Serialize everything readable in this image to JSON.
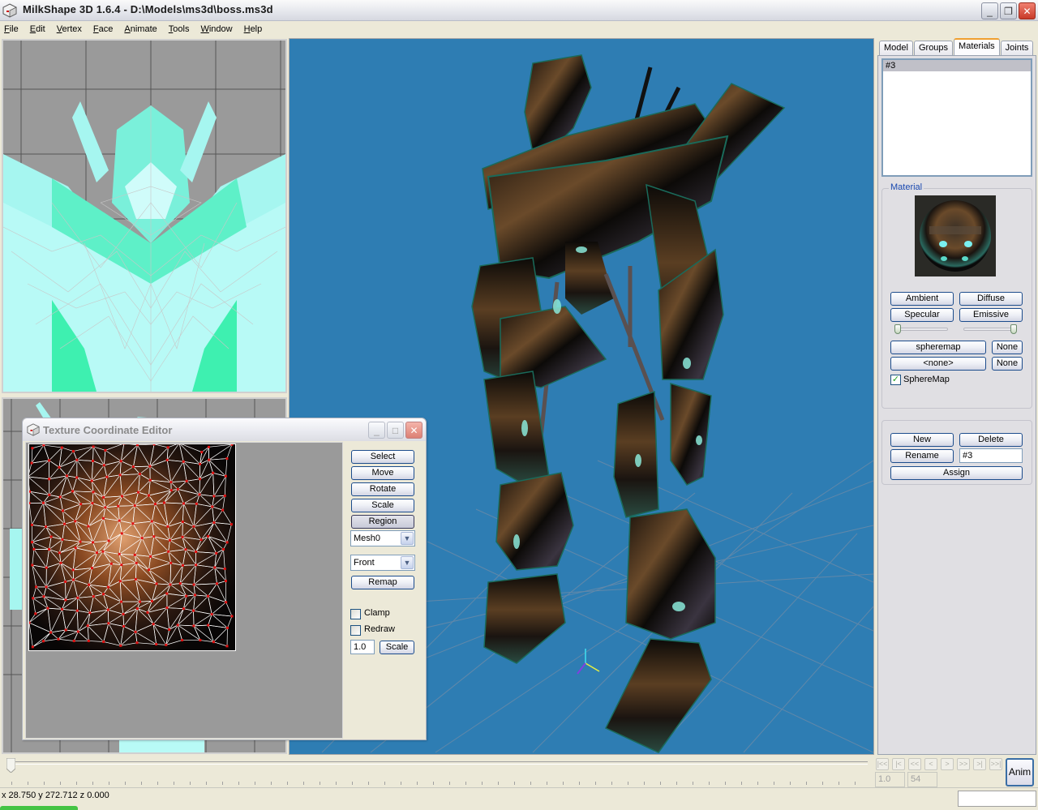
{
  "window": {
    "title": "MilkShape 3D 1.6.4 - D:\\Models\\ms3d\\boss.ms3d",
    "icon": "milkshape-cube-icon",
    "controls": {
      "minimize": "_",
      "restore": "❐",
      "close": "✕"
    }
  },
  "menu": [
    "File",
    "Edit",
    "Vertex",
    "Face",
    "Animate",
    "Tools",
    "Window",
    "Help"
  ],
  "viewports": {
    "front": {
      "name": "front-wireframe-view"
    },
    "side": {
      "name": "side-wireframe-view"
    },
    "perspective": {
      "name": "3d-perspective-view",
      "background": "#2e7db3"
    }
  },
  "right_panel": {
    "tabs": [
      {
        "label": "Model",
        "active": false
      },
      {
        "label": "Groups",
        "active": false
      },
      {
        "label": "Materials",
        "active": true
      },
      {
        "label": "Joints",
        "active": false
      }
    ],
    "materials": [
      "#3"
    ],
    "selected_material": "#3",
    "material_group_label": "Material",
    "buttons": {
      "ambient": "Ambient",
      "diffuse": "Diffuse",
      "specular": "Specular",
      "emissive": "Emissive",
      "texture1": "spheremap",
      "texture1_none": "None",
      "texture2": "<none>",
      "texture2_none": "None"
    },
    "shininess_slider": 0.0,
    "transparency_slider": 1.0,
    "spheremap_checkbox": {
      "label": "SphereMap",
      "checked": true
    },
    "actions": {
      "new": "New",
      "delete": "Delete",
      "rename": "Rename",
      "rename_value": "#3",
      "assign": "Assign"
    }
  },
  "texture_editor": {
    "title": "Texture Coordinate Editor",
    "controls": {
      "minimize": "_",
      "maximize": "□",
      "close": "✕"
    },
    "buttons": {
      "select": "Select",
      "move": "Move",
      "rotate": "Rotate",
      "scale": "Scale",
      "region": "Region",
      "remap": "Remap",
      "scale_apply": "Scale"
    },
    "mesh_dropdown": "Mesh0",
    "projection_dropdown": "Front",
    "clamp": {
      "label": "Clamp",
      "checked": false
    },
    "redraw": {
      "label": "Redraw",
      "checked": false
    },
    "scale_value": "1.0"
  },
  "timeline": {
    "position": 0.0,
    "nav_buttons": [
      "|<<",
      "|<",
      "<<",
      "<",
      ">",
      ">>",
      ">|",
      ">>|"
    ],
    "nav_glyphs": [
      "⏮",
      "|<",
      "«",
      "‹",
      "›",
      "»",
      ">|",
      "⏭"
    ],
    "frame_value": "1.0",
    "total_frames": "54",
    "anim_button": "Anim"
  },
  "status": {
    "coordinates": "x 28.750 y 272.712 z 0.000"
  }
}
